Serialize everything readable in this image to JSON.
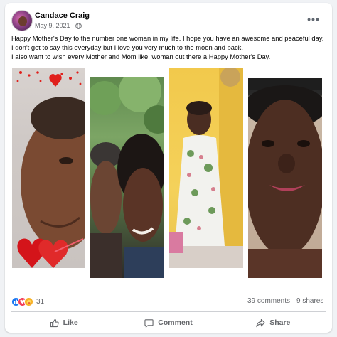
{
  "post": {
    "author_name": "Candace Craig",
    "date": "May 9, 2021",
    "separator": "·",
    "privacy_icon": "globe-icon",
    "more_icon": "more-horizontal-icon",
    "more_label": "•••",
    "text_lines": [
      "Happy Mother's Day to the number one woman in my life. I hope you have an awesome and peaceful day. I don't get to say this everyday but I love you very much to the moon and back.",
      "I also want to wish every Mother and Mom  like, woman out there a Happy Mother's Day."
    ]
  },
  "photos": [
    {
      "description_icon": "photo-1"
    },
    {
      "description_icon": "photo-2"
    },
    {
      "description_icon": "photo-3"
    },
    {
      "description_icon": "photo-4"
    }
  ],
  "stats": {
    "reaction_icons": [
      "like-icon",
      "love-icon",
      "care-icon"
    ],
    "reaction_count": "31",
    "comments": "39 comments",
    "shares": "9 shares"
  },
  "actions": {
    "like_label": "Like",
    "comment_label": "Comment",
    "share_label": "Share"
  },
  "colors": {
    "page_bg": "#f0f2f5",
    "card_bg": "#ffffff",
    "secondary_text": "#65676b",
    "like_blue": "#1877f2",
    "love_red": "#f33e58",
    "care_yellow": "#f7b125"
  }
}
